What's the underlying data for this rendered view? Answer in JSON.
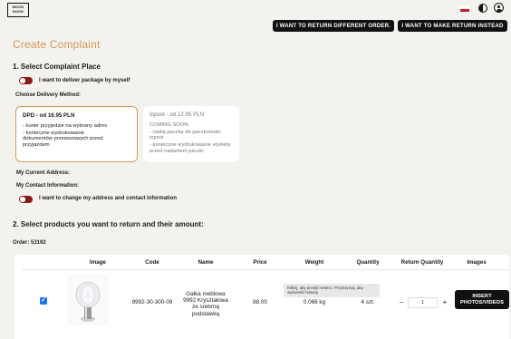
{
  "header": {
    "logo_line1": "MOOD",
    "logo_line2": "NOOK",
    "btn_return_different": "I WANT TO RETURN DIFFERENT ORDER.",
    "btn_make_return": "I WANT TO MAKE RETURN INSTEAD",
    "icons": [
      "poland-flag-icon",
      "contrast-icon",
      "user-account-icon"
    ]
  },
  "page": {
    "title": "Create Complaint"
  },
  "section1": {
    "heading": "1. Select Complaint Place",
    "toggle_deliver": "I want to deliver package by myself",
    "delivery_heading": "Choose Delivery Method:",
    "methods": [
      {
        "title": "DPD - od 16.95 PLN",
        "lines": [
          "- kurier przyjedzie na wybrany adres",
          "- konieczne wydrukowanie",
          "dokumentów przewozowych przed",
          "przyjazdem"
        ],
        "selected": true
      },
      {
        "title": "Inpost - od 12.95 PLN",
        "lines": [
          "COMING SOON",
          "- nadaj paczkę do paczkomatu inpost",
          "- konieczne wydrukowanie etykiety",
          "przed nadaniem paczki"
        ],
        "selected": false
      }
    ],
    "current_address": "My Current Address:",
    "contact_info": "My Contact Information:",
    "toggle_change_address": "I want to change my address and contact information"
  },
  "section2": {
    "heading": "2. Select products you want to return and their amount:",
    "order_label": "Order: 53192",
    "columns": [
      "Image",
      "Code",
      "Name",
      "Price",
      "Weight",
      "Quantity",
      "Return Quantity",
      "Images"
    ],
    "row": {
      "checked": true,
      "code": "9992-30-300-09",
      "name_lines": [
        "Gałka meblowa",
        "9992 Kryształowa",
        "ze srebrną",
        "podstawką"
      ],
      "price": "88.00",
      "weight": "0.066 kg",
      "quantity": "4 szt.",
      "return_qty": "1",
      "minus": "−",
      "plus": "+",
      "insert_btn_line1": "INSERT",
      "insert_btn_line2": "PHOTOS/VIDEOS",
      "tooltip_line1": "Kliknij, aby przejść wstecz. Przytrzymaj, aby",
      "tooltip_line2": "wyświetlić historię"
    }
  },
  "colors": {
    "accent": "#d39957",
    "toggle": "#8c1818",
    "background": "#f4f2ee",
    "checkbox": "#1a73e8"
  }
}
